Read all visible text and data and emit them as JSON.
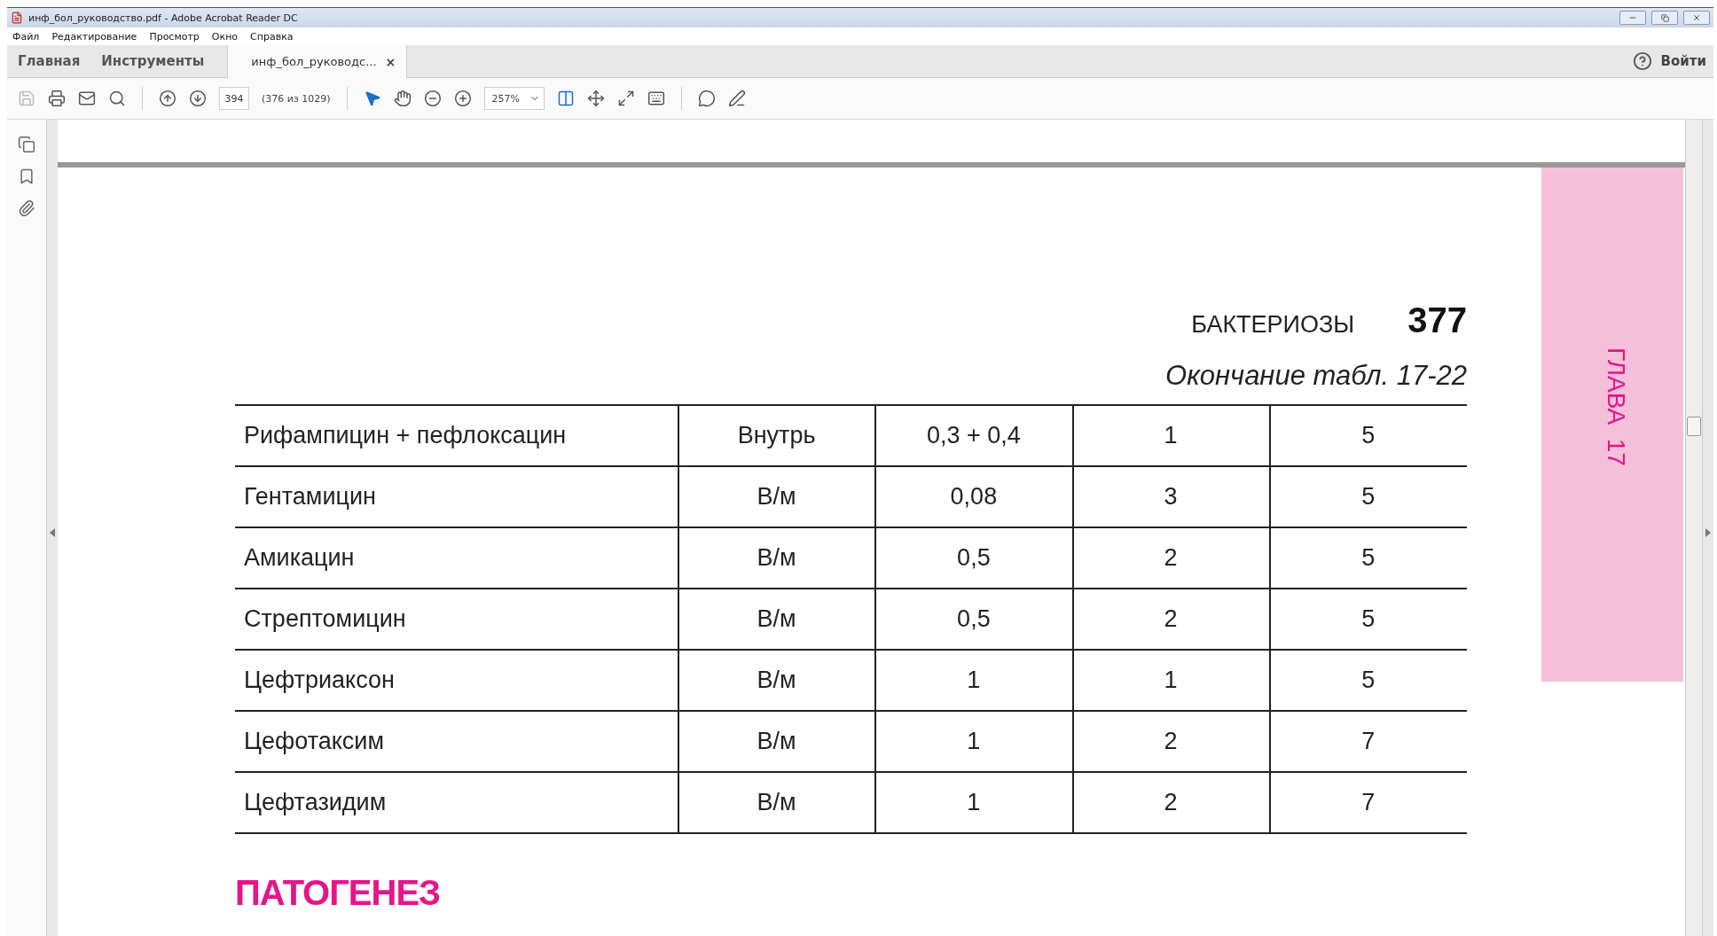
{
  "window": {
    "title": "инф_бол_руководство.pdf - Adobe Acrobat Reader DC"
  },
  "menu": [
    "Файл",
    "Редактирование",
    "Просмотр",
    "Окно",
    "Справка"
  ],
  "tabs": [
    {
      "label": "Главная",
      "selected": false
    },
    {
      "label": "Инструменты",
      "selected": false
    },
    {
      "label": "инф_бол_руководс...",
      "selected": true,
      "close": "×"
    }
  ],
  "signin": "Войти",
  "toolbar": {
    "page_number": "394",
    "page_count": "(376 из 1029)",
    "zoom": "257%"
  },
  "document": {
    "section": "БАКТЕРИОЗЫ",
    "page": "377",
    "caption": "Окончание табл. 17-22",
    "rows": [
      [
        "Рифампицин + пефлоксацин",
        "Внутрь",
        "0,3 + 0,4",
        "1",
        "5"
      ],
      [
        "Гентамицин",
        "В/м",
        "0,08",
        "3",
        "5"
      ],
      [
        "Амикацин",
        "В/м",
        "0,5",
        "2",
        "5"
      ],
      [
        "Стрептомицин",
        "В/м",
        "0,5",
        "2",
        "5"
      ],
      [
        "Цефтриаксон",
        "В/м",
        "1",
        "1",
        "5"
      ],
      [
        "Цефотаксим",
        "В/м",
        "1",
        "2",
        "7"
      ],
      [
        "Цефтазидим",
        "В/м",
        "1",
        "2",
        "7"
      ]
    ],
    "heading": "ПАТОГЕНЕЗ",
    "side_tab": "ГЛАВА  17"
  }
}
